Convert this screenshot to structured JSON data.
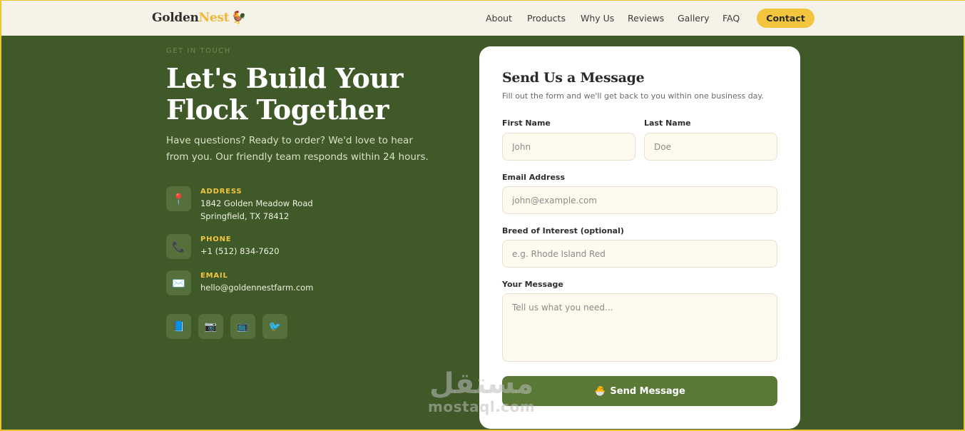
{
  "brand": {
    "name_a": "Golden",
    "name_b": "Nest",
    "logo_glyph": "🐓"
  },
  "nav": {
    "links": [
      "About",
      "Products",
      "Why Us",
      "Reviews",
      "Gallery",
      "FAQ"
    ],
    "cta": "Contact"
  },
  "hero": {
    "eyebrow": "GET IN TOUCH",
    "title_line1": "Let's Build Your",
    "title_line2": "Flock Together",
    "lede": "Have questions? Ready to order? We'd love to hear from you. Our friendly team responds within 24 hours."
  },
  "contact": {
    "address": {
      "label": "ADDRESS",
      "line1": "1842 Golden Meadow Road",
      "line2": "Springfield, TX 78412",
      "icon": "pin-icon"
    },
    "phone": {
      "label": "PHONE",
      "value": "+1 (512) 834-7620",
      "icon": "phone-icon"
    },
    "email": {
      "label": "EMAIL",
      "value": "hello@goldennestfarm.com",
      "icon": "envelope-icon"
    }
  },
  "socials": [
    "book-icon",
    "camera-icon",
    "tv-icon",
    "bird-icon"
  ],
  "form": {
    "title": "Send Us a Message",
    "subtitle": "Fill out the form and we'll get back to you within one business day.",
    "first_name": {
      "label": "First Name",
      "placeholder": "John"
    },
    "last_name": {
      "label": "Last Name",
      "placeholder": "Doe"
    },
    "email": {
      "label": "Email Address",
      "placeholder": "john@example.com"
    },
    "breed": {
      "label": "Breed of Interest (optional)",
      "placeholder": "e.g. Rhode Island Red"
    },
    "message": {
      "label": "Your Message",
      "placeholder": "Tell us what you need..."
    },
    "submit": "Send Message"
  },
  "watermark": {
    "arabic": "مستقل",
    "latin": "mostaql.com"
  },
  "colors": {
    "accent": "#f3c53f",
    "background": "#3f5a28",
    "button": "#5a7936"
  }
}
